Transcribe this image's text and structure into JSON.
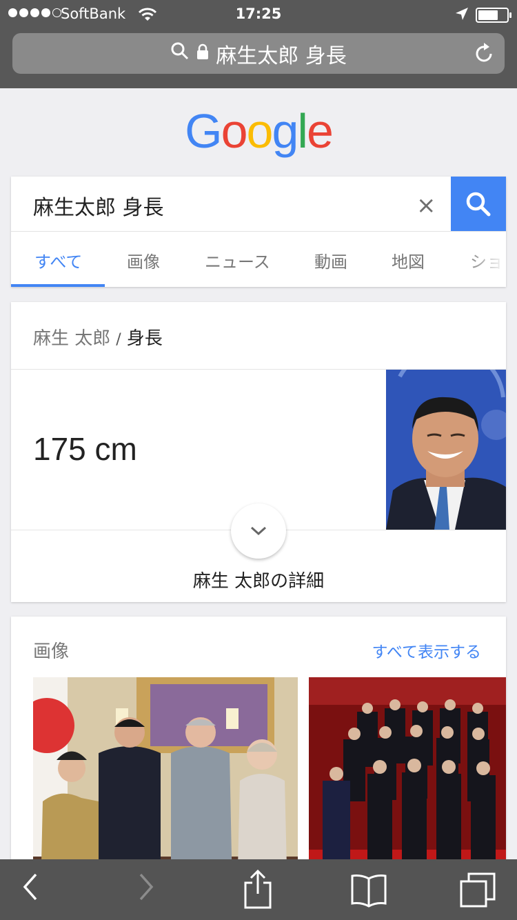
{
  "status_bar": {
    "carrier": "SoftBank",
    "time": "17:25",
    "signal_bars_filled": 4,
    "signal_bars_total": 5
  },
  "url_bar": {
    "text": "麻生太郎 身長",
    "icons": [
      "search-icon",
      "lock-icon",
      "reload-icon"
    ]
  },
  "google_logo": {
    "letters": [
      "G",
      "o",
      "o",
      "g",
      "l",
      "e"
    ],
    "colors": [
      "#4285f4",
      "#ea4335",
      "#fbbc05",
      "#4285f4",
      "#34a853",
      "#ea4335"
    ]
  },
  "search": {
    "query": "麻生太郎 身長",
    "clear_icon": "×",
    "tabs": [
      {
        "label": "すべて",
        "active": true
      },
      {
        "label": "画像",
        "active": false
      },
      {
        "label": "ニュース",
        "active": false
      },
      {
        "label": "動画",
        "active": false
      },
      {
        "label": "地図",
        "active": false
      },
      {
        "label": "ショ",
        "active": false
      }
    ]
  },
  "knowledge_card": {
    "entity": "麻生 太郎",
    "separator": "/",
    "attribute": "身長",
    "value": "175 cm",
    "details_label": "麻生 太郎の詳細"
  },
  "images_card": {
    "title": "画像",
    "show_all": "すべて表示する"
  },
  "toolbar": {
    "icons": [
      "back-icon",
      "forward-icon",
      "share-icon",
      "bookmarks-icon",
      "tabs-icon"
    ]
  },
  "colors": {
    "accent": "#4285f4",
    "chrome": "#585858",
    "page_bg": "#efeff2"
  }
}
